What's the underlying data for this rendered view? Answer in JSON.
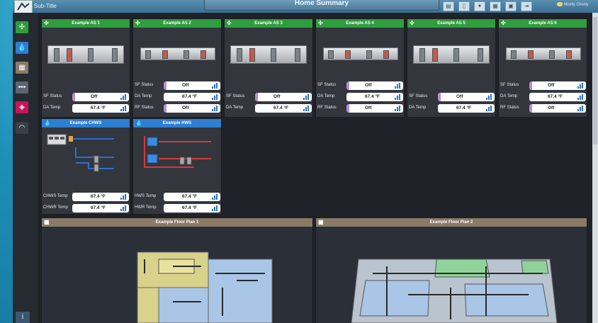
{
  "header": {
    "subtitle": "Sub-Title",
    "title": "Home Summary",
    "weather": "Mostly Cloudy"
  },
  "sidebar": {
    "info_label": "i"
  },
  "air_systems": [
    {
      "title": "Example AS 1",
      "points": [
        {
          "label": "SF Status",
          "value": "Off"
        },
        {
          "label": "DA Temp",
          "value": "67.4 °F"
        }
      ]
    },
    {
      "title": "Example AS 2",
      "points": [
        {
          "label": "SF Status",
          "value": "Off"
        },
        {
          "label": "DA Temp",
          "value": "67.4 °F"
        },
        {
          "label": "RF Status",
          "value": "Off"
        }
      ]
    },
    {
      "title": "Example AS 3",
      "points": [
        {
          "label": "SF Status",
          "value": "Off"
        },
        {
          "label": "DA Temp",
          "value": "67.4 °F"
        }
      ]
    },
    {
      "title": "Example AS 4",
      "points": [
        {
          "label": "SF Status",
          "value": "Off"
        },
        {
          "label": "DA Temp",
          "value": "67.4 °F"
        },
        {
          "label": "RF Status",
          "value": "Off"
        }
      ]
    },
    {
      "title": "Example AS 5",
      "points": [
        {
          "label": "SF Status",
          "value": "Off"
        },
        {
          "label": "DA Temp",
          "value": "67.4 °F"
        }
      ]
    },
    {
      "title": "Example AS 6",
      "points": [
        {
          "label": "SF Status",
          "value": "Off"
        },
        {
          "label": "DA Temp",
          "value": "67.4 °F"
        },
        {
          "label": "RF Status",
          "value": "Off"
        }
      ]
    }
  ],
  "plants": [
    {
      "title": "Example CHWS",
      "points": [
        {
          "label": "CHWS Temp",
          "value": "67.4 °F"
        },
        {
          "label": "CHWR Temp",
          "value": "67.4 °F"
        }
      ]
    },
    {
      "title": "Example HWS",
      "points": [
        {
          "label": "HWS Temp",
          "value": "67.4 °F"
        },
        {
          "label": "HWR Temp",
          "value": "67.4 °F"
        }
      ]
    }
  ],
  "floorplans": [
    {
      "title": "Example Floor Plan 1"
    },
    {
      "title": "Example Floor Plan 2"
    }
  ],
  "colors": {
    "green": "#2f9e3d",
    "blue": "#2d7fd1",
    "tan": "#8a7a68"
  }
}
